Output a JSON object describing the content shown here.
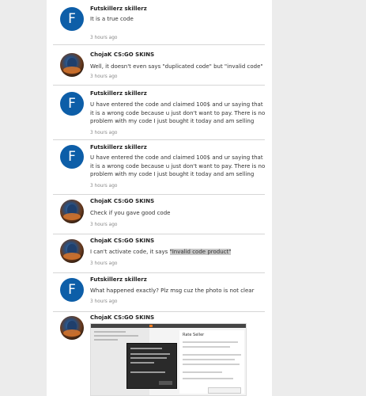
{
  "messages": [
    {
      "author": "Futskillerz skillerz",
      "initial": "F",
      "avatar": "letter",
      "text": "It is a true code",
      "time": "3 hours ago"
    },
    {
      "author": "ChojaK CS:GO SKINS",
      "avatar": "photo",
      "text": "Well, it doesn't even says \"duplicated code\" but \"invalid code\"",
      "time": "3 hours ago"
    },
    {
      "author": "Futskillerz skillerz",
      "initial": "F",
      "avatar": "letter",
      "text": "U have entered the code and claimed 100$ and ur saying that it is a wrong code because u just don't want to pay. There is no problem with my code I just bought it today and am selling",
      "time": "3 hours ago"
    },
    {
      "author": "Futskillerz skillerz",
      "initial": "F",
      "avatar": "letter",
      "text": "U have entered the code and claimed 100$ and ur saying that it is a wrong code because u just don't want to pay. There is no problem with my code I just bought it today and am selling",
      "time": "3 hours ago"
    },
    {
      "author": "ChojaK CS:GO SKINS",
      "avatar": "photo",
      "text": "Check if you gave good code",
      "time": "3 hours ago"
    },
    {
      "author": "ChojaK CS:GO SKINS",
      "avatar": "photo",
      "text_prefix": "I can't activate code, it says ",
      "text_highlight": "\"Invalid code product\"",
      "time": "3 hours ago"
    },
    {
      "author": "Futskillerz skillerz",
      "initial": "F",
      "avatar": "letter",
      "text": "What happened exactly? Plz msg cuz the photo is not clear",
      "time": "3 hours ago"
    },
    {
      "author": "ChojaK CS:GO SKINS",
      "avatar": "photo",
      "attachment": {
        "panel_title": "Rate Seller"
      }
    }
  ]
}
